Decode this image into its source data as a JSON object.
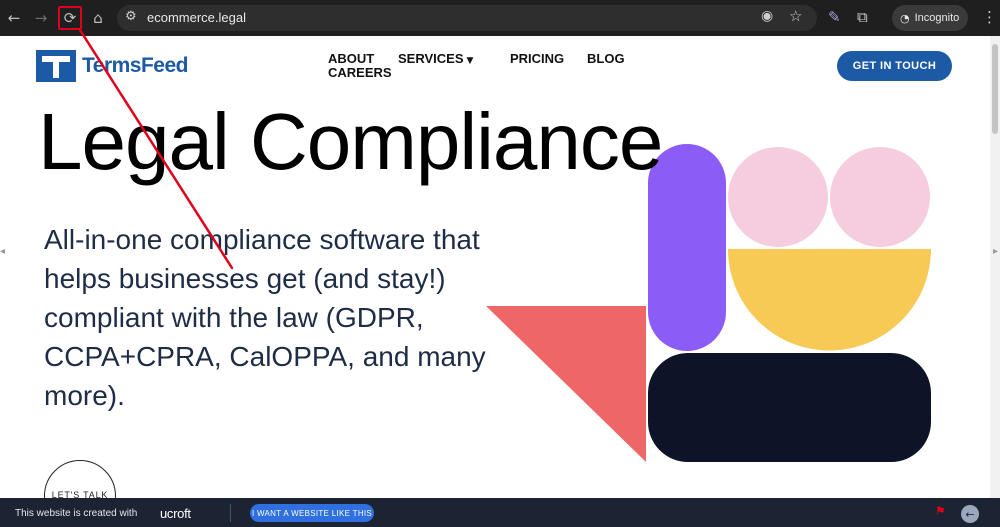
{
  "browser": {
    "back_icon": "←",
    "forward_icon": "→",
    "reload_icon": "⟳",
    "home_icon": "⌂",
    "site_settings_icon": "⚙",
    "url": "ecommerce.legal",
    "eye_off_icon": "◉",
    "star_icon": "☆",
    "extension_icon": "✎",
    "puzzle_icon": "⧉",
    "incognito_icon": "◔",
    "incognito_label": "Incognito",
    "menu_icon": "⋮"
  },
  "site": {
    "logo_text": "TermsFeed",
    "nav": {
      "about": "ABOUT",
      "careers": "CAREERS",
      "services": "SERVICES",
      "services_caret": "▼",
      "pricing": "PRICING",
      "blog": "BLOG"
    },
    "cta_label": "GET IN TOUCH",
    "hero_title": "Legal Compliance",
    "hero_subtitle": "All-in-one compliance software that helps businesses get (and stay!) compliant with the law (GDPR, CCPA+CPRA, CalOPPA, and many more).",
    "lets_talk": "LET'S TALK",
    "colors": {
      "brand_blue": "#1d5aa6",
      "purple": "#8b5cf6",
      "pink": "#f5cddf",
      "yellow": "#f7c955",
      "coral": "#ef6666",
      "navy": "#0d1428"
    }
  },
  "footer": {
    "created_text": "This website is created with",
    "builder_logo": "ucroft",
    "button_label": "I WANT A WEBSITE LIKE THIS",
    "flag_icon": "⚑",
    "back_icon": "←"
  },
  "annotation_color": "#e0001b"
}
